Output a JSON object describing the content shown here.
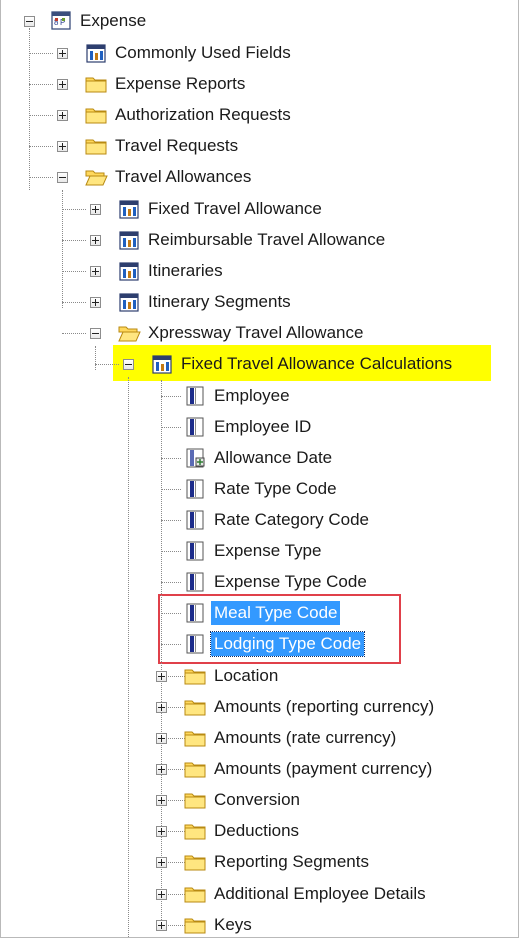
{
  "tree": {
    "root": {
      "label": "Expense",
      "icon": "module-icon"
    },
    "items": [
      {
        "label": "Commonly Used Fields",
        "icon": "table-icon"
      },
      {
        "label": "Expense Reports",
        "icon": "folder-icon"
      },
      {
        "label": "Authorization Requests",
        "icon": "folder-icon"
      },
      {
        "label": "Travel Requests",
        "icon": "folder-icon"
      },
      {
        "label": "Travel Allowances",
        "icon": "folder-open-icon"
      },
      {
        "label": "Fixed Travel Allowance",
        "icon": "table-icon"
      },
      {
        "label": "Reimbursable Travel Allowance",
        "icon": "table-icon"
      },
      {
        "label": "Itineraries",
        "icon": "table-icon"
      },
      {
        "label": "Itinerary Segments",
        "icon": "table-icon"
      },
      {
        "label": "Xpressway Travel Allowance",
        "icon": "folder-open-icon"
      },
      {
        "label": "Fixed Travel Allowance Calculations",
        "icon": "table-icon"
      },
      {
        "label": "Employee",
        "icon": "field-icon"
      },
      {
        "label": "Employee ID",
        "icon": "field-icon"
      },
      {
        "label": "Allowance Date",
        "icon": "date-field-icon"
      },
      {
        "label": "Rate Type Code",
        "icon": "field-icon"
      },
      {
        "label": "Rate Category Code",
        "icon": "field-icon"
      },
      {
        "label": "Expense Type",
        "icon": "field-icon"
      },
      {
        "label": "Expense Type Code",
        "icon": "field-icon"
      },
      {
        "label": "Meal Type Code",
        "icon": "field-icon"
      },
      {
        "label": "Lodging Type Code",
        "icon": "field-icon"
      },
      {
        "label": "Location",
        "icon": "folder-icon"
      },
      {
        "label": "Amounts (reporting currency)",
        "icon": "folder-icon"
      },
      {
        "label": "Amounts (rate currency)",
        "icon": "folder-icon"
      },
      {
        "label": "Amounts (payment currency)",
        "icon": "folder-icon"
      },
      {
        "label": "Conversion",
        "icon": "folder-icon"
      },
      {
        "label": "Deductions",
        "icon": "folder-icon"
      },
      {
        "label": "Reporting Segments",
        "icon": "folder-icon"
      },
      {
        "label": "Additional Employee Details",
        "icon": "folder-icon"
      },
      {
        "label": "Keys",
        "icon": "folder-icon"
      }
    ]
  },
  "colors": {
    "selection": "#3399ff",
    "highlight": "#ffff00",
    "annotation_border": "#e0404a"
  }
}
